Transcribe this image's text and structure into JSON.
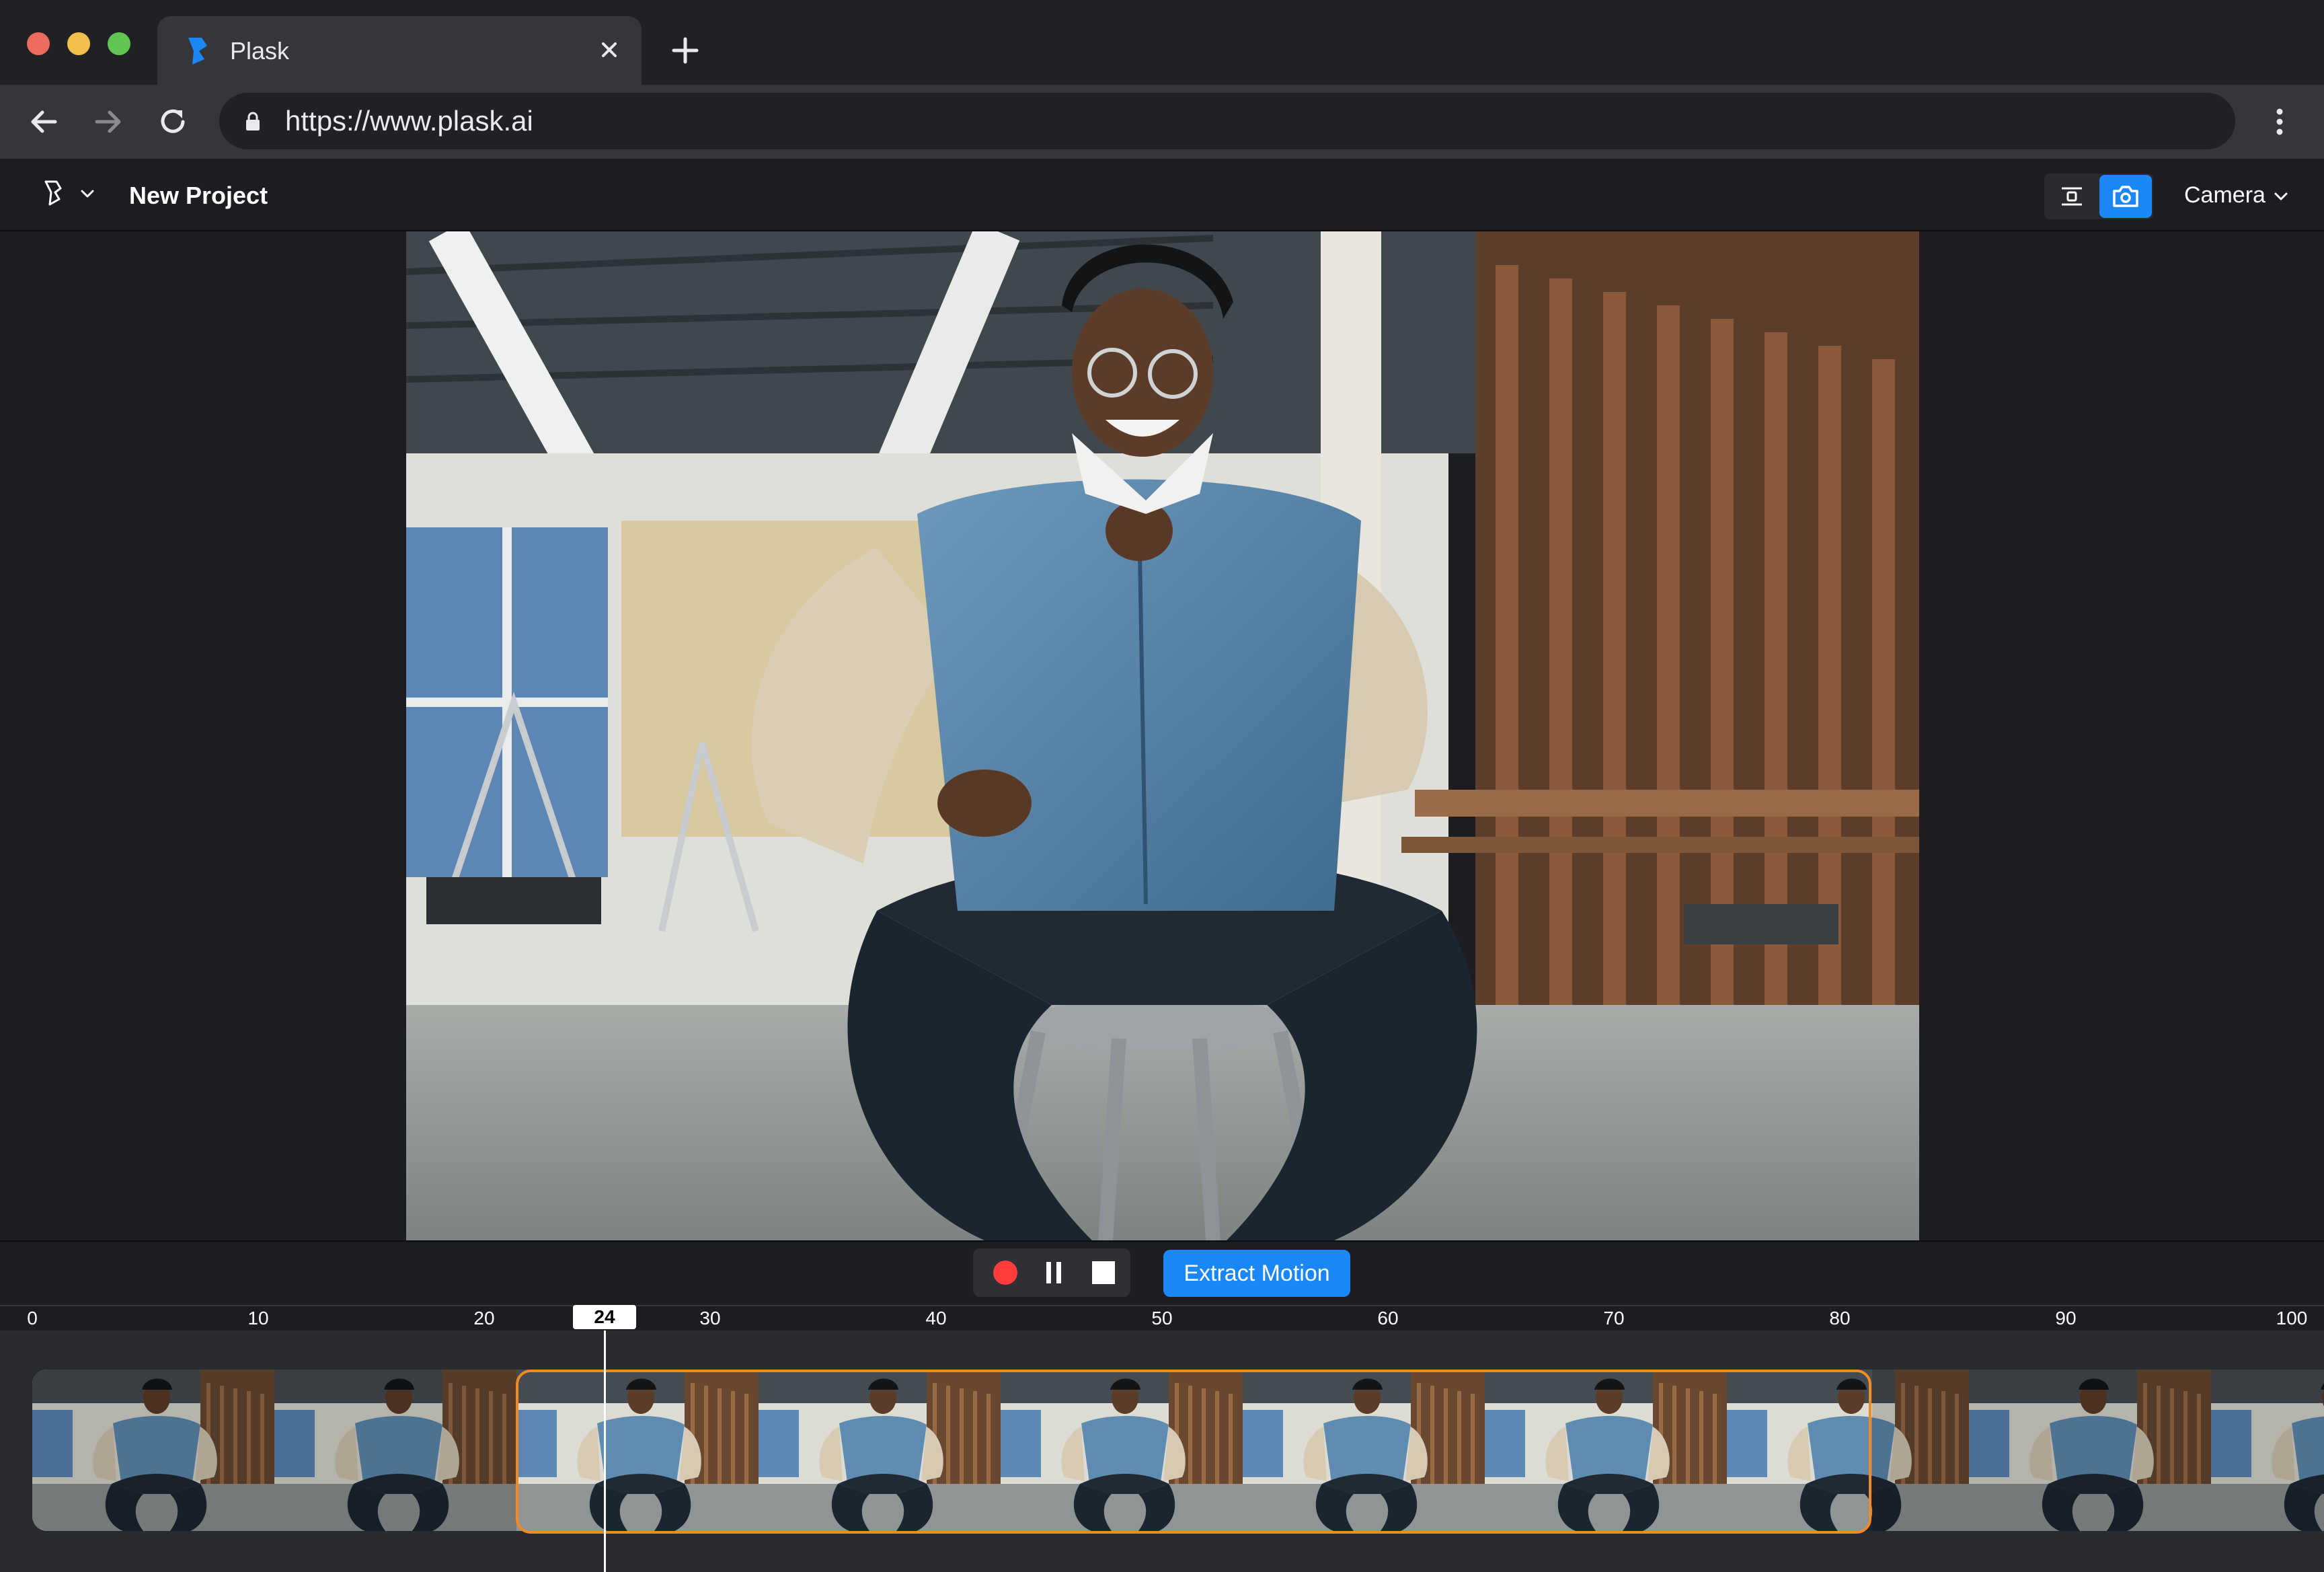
{
  "browser": {
    "tab_title": "Plask",
    "url": "https://www.plask.ai",
    "icons": {
      "favicon": "plask-logo",
      "close": "close-icon",
      "new_tab": "plus-icon",
      "back": "arrow-left-icon",
      "forward": "arrow-right-icon",
      "reload": "reload-icon",
      "lock": "lock-icon",
      "menu": "more-vertical-icon"
    }
  },
  "header": {
    "project_title": "New Project",
    "view_mode": "Camera",
    "mode_buttons": [
      {
        "icon": "fit-frame-icon",
        "active": false
      },
      {
        "icon": "camera-icon",
        "active": true
      }
    ]
  },
  "controls": {
    "extract_label": "Extract Motion",
    "transport": [
      {
        "icon": "record-icon"
      },
      {
        "icon": "pause-icon"
      },
      {
        "icon": "stop-icon"
      }
    ]
  },
  "timeline": {
    "ticks": [
      "0",
      "10",
      "20",
      "30",
      "40",
      "50",
      "60",
      "70",
      "80",
      "90",
      "100"
    ],
    "current_frame": "24",
    "selection_start_frame": 22,
    "selection_end_frame": 81
  },
  "colors": {
    "accent": "#1b86f5",
    "selection": "#f08a24",
    "record": "#ff3b3b"
  }
}
